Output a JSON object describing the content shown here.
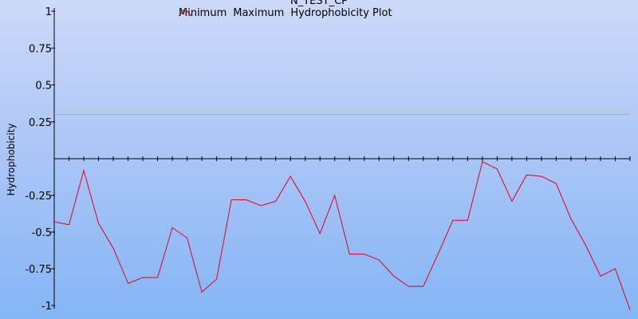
{
  "chart_data": {
    "type": "line",
    "title": "N_TEST_CP",
    "ylabel": "Hydrophobicity",
    "xlabel": "",
    "ylim": [
      -1,
      1
    ],
    "yticks": [
      {
        "value": 1,
        "label": "1"
      },
      {
        "value": 0.75,
        "label": "0.75"
      },
      {
        "value": 0.5,
        "label": "0.5"
      },
      {
        "value": 0.25,
        "label": "0.25"
      },
      {
        "value": -0.25,
        "label": "-0.25"
      },
      {
        "value": -0.5,
        "label": "-0.5"
      },
      {
        "value": -0.75,
        "label": "-0.75"
      },
      {
        "value": -1,
        "label": "-1"
      }
    ],
    "x": [
      0,
      1,
      2,
      3,
      4,
      5,
      6,
      7,
      8,
      9,
      10,
      11,
      12,
      13,
      14,
      15,
      16,
      17,
      18,
      19,
      20,
      21,
      22,
      23,
      24,
      25,
      26,
      27,
      28,
      29,
      30,
      31,
      32,
      33,
      34,
      35,
      36,
      37,
      38,
      39
    ],
    "series": [
      {
        "name": "Minimum",
        "color": "#f0a030",
        "values": [
          0.3,
          0.3,
          0.3,
          0.3,
          0.3,
          0.3,
          0.3,
          0.3,
          0.3,
          0.3,
          0.3,
          0.3,
          0.3,
          0.3,
          0.3,
          0.3,
          0.3,
          0.3,
          0.3,
          0.3,
          0.3,
          0.3,
          0.3,
          0.3,
          0.3,
          0.3,
          0.3,
          0.3,
          0.3,
          0.3,
          0.3,
          0.3,
          0.3,
          0.3,
          0.3,
          0.3,
          0.3,
          0.3,
          0.3,
          0.3
        ]
      },
      {
        "name": "Maximum",
        "color": "#00a000",
        "values": []
      },
      {
        "name": "Hydrophobicity Plot",
        "color": "#e00020",
        "values": [
          -0.43,
          -0.45,
          -0.08,
          -0.44,
          -0.61,
          -0.85,
          -0.81,
          -0.81,
          -0.47,
          -0.54,
          -0.91,
          -0.82,
          -0.28,
          -0.28,
          -0.32,
          -0.29,
          -0.12,
          -0.29,
          -0.51,
          -0.25,
          -0.65,
          -0.65,
          -0.69,
          -0.8,
          -0.87,
          -0.87,
          -0.65,
          -0.42,
          -0.42,
          -0.02,
          -0.07,
          -0.29,
          -0.11,
          -0.12,
          -0.17,
          -0.41,
          -0.59,
          -0.8,
          -0.75,
          -1.03
        ]
      }
    ],
    "grid": false,
    "legend": "top"
  }
}
